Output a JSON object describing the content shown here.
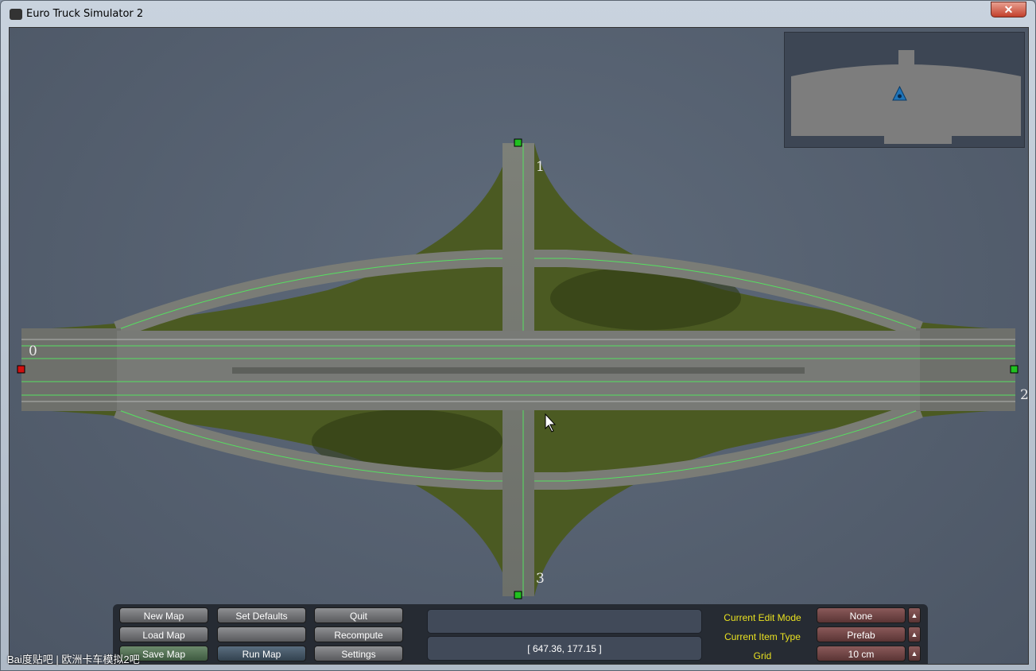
{
  "window": {
    "title": "Euro Truck Simulator 2",
    "close_icon": "close-icon"
  },
  "scene": {
    "node_labels": [
      "0",
      "1",
      "2",
      "3"
    ],
    "node_colors": {
      "start": "#d01010",
      "end": "#20c020"
    }
  },
  "panel": {
    "buttons": [
      [
        "New Map",
        "Set Defaults",
        "Quit"
      ],
      [
        "Load Map",
        "",
        "Recompute"
      ],
      [
        "Save Map",
        "Run Map",
        "Settings"
      ]
    ],
    "status_text": "",
    "coordinates": "[ 647.36, 177.15 ]",
    "fields": [
      {
        "label": "Current Edit Mode",
        "value": "None"
      },
      {
        "label": "Current Item Type",
        "value": "Prefab"
      },
      {
        "label": "Grid",
        "value": "10 cm"
      }
    ]
  },
  "watermark": "Bai度贴吧 | 欧洲卡车模拟2吧"
}
